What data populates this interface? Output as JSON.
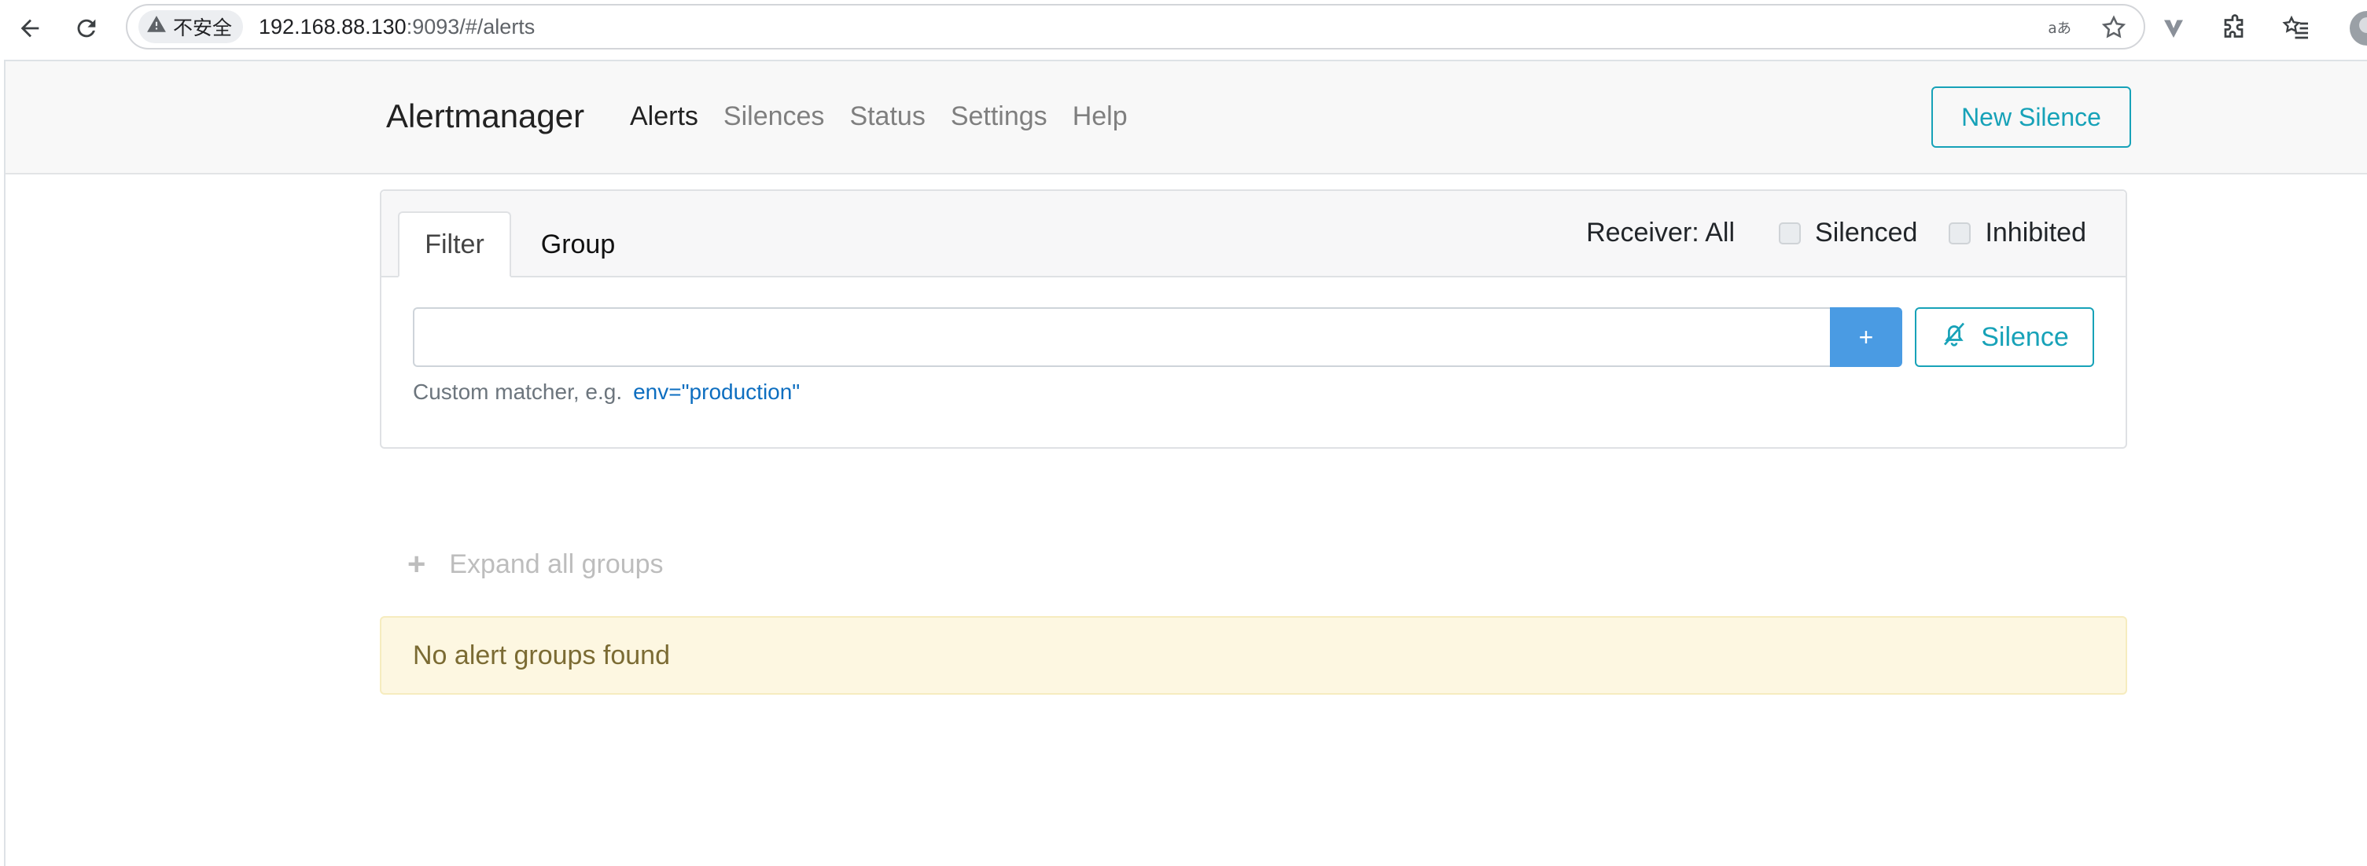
{
  "browser": {
    "security_label": "不安全",
    "url_host": "192.168.88.130",
    "url_rest": ":9093/#/alerts",
    "icons": [
      "back-icon",
      "reload-icon",
      "warning-icon",
      "translate-icon",
      "star-icon",
      "vivaldi-icon",
      "extensions-icon",
      "favorites-icon",
      "profile-avatar"
    ]
  },
  "navbar": {
    "brand": "Alertmanager",
    "links": [
      {
        "label": "Alerts",
        "active": true
      },
      {
        "label": "Silences"
      },
      {
        "label": "Status"
      },
      {
        "label": "Settings"
      },
      {
        "label": "Help"
      }
    ],
    "new_silence": "New Silence"
  },
  "filter_card": {
    "tabs": [
      "Filter",
      "Group"
    ],
    "active_tab": "Filter",
    "receiver_label": "Receiver: All",
    "silenced_label": "Silenced",
    "inhibited_label": "Inhibited",
    "silenced_checked": false,
    "inhibited_checked": false,
    "input_value": "",
    "add_button": "+",
    "silence_button": "Silence",
    "hint_text": "Custom matcher, e.g.",
    "hint_example": "env=\"production\""
  },
  "expand_label": "Expand all groups",
  "empty_message": "No alert groups found",
  "colors": {
    "accent_info": "#17a2b8",
    "primary": "#4a9be3",
    "warning_bg": "#fdf7e1"
  }
}
